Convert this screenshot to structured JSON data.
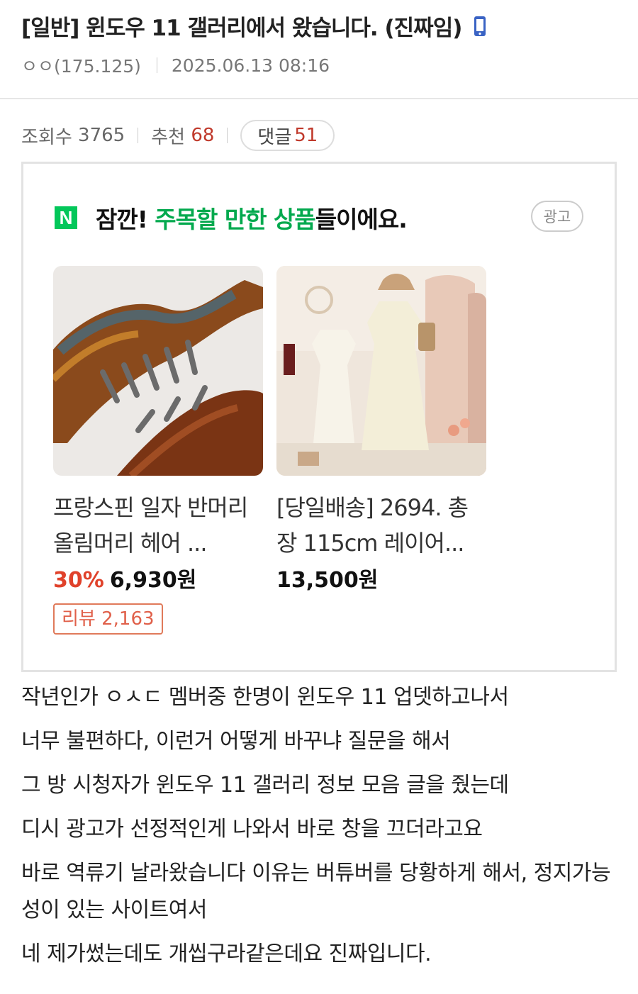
{
  "post": {
    "title": "[일반] 윈도우 11 갤러리에서 왔습니다. (진짜임)",
    "author": "ㅇㅇ(175.125)",
    "date": "2025.06.13 08:16",
    "mobile_icon": "mobile-phone-icon"
  },
  "stats": {
    "views_label": "조회수",
    "views": "3765",
    "likes_label": "추천",
    "likes": "68",
    "comments_label": "댓글",
    "comments": "51"
  },
  "ad": {
    "logo_text": "N",
    "title_prefix": "잠깐! ",
    "title_highlight": "주목할 만한 상품",
    "title_suffix": "들이에요.",
    "badge": "광고",
    "accent_color": "#03c75a",
    "products": [
      {
        "name": "프랑스핀 일자 반머리 올림머리 헤어 ...",
        "discount": "30%",
        "price": "6,930원",
        "review": "리뷰 2,163"
      },
      {
        "name": "[당일배송] 2694. 총장 115cm 레이어...",
        "price": "13,500원"
      }
    ]
  },
  "body": {
    "paragraphs": [
      "작년인가 ㅇㅅㄷ 멤버중 한명이 윈도우 11 업뎃하고나서",
      "너무 불편하다, 이런거 어떻게 바꾸냐 질문을 해서",
      "그 방 시청자가 윈도우 11 갤러리 정보 모음 글을 줬는데",
      "디시 광고가 선정적인게 나와서 바로 창을 끄더라고요",
      "바로 역류기 날라왔습니다 이유는 버튜버를 당황하게 해서, 정지가능성이 있는 사이트여서",
      "네 제가썼는데도 개씹구라같은데요 진짜입니다."
    ]
  }
}
